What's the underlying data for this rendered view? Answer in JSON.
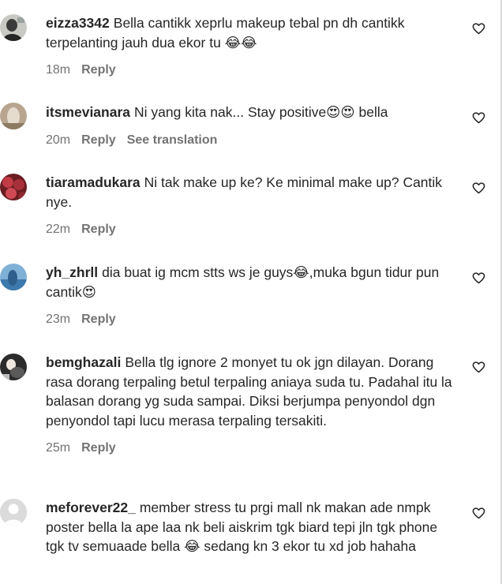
{
  "comments": [
    {
      "username": "eizza3342",
      "text": "Bella cantikk xeprlu makeup tebal pn dh cantikk terpelanting jauh dua ekor tu 😂😂",
      "time": "18m",
      "reply_label": "Reply"
    },
    {
      "username": "itsmevianara",
      "text": "Ni yang kita nak... Stay positive😍😍 bella",
      "time": "20m",
      "reply_label": "Reply",
      "translate_label": "See translation"
    },
    {
      "username": "tiaramadukara",
      "text": "Ni tak make up ke? Ke minimal make up? Cantik nye.",
      "time": "22m",
      "reply_label": "Reply"
    },
    {
      "username": "yh_zhrll",
      "text": "dia buat ig mcm stts ws je guys😂,muka bgun tidur pun cantik😍",
      "time": "23m",
      "reply_label": "Reply"
    },
    {
      "username": "bemghazali",
      "text": "Bella tlg ignore 2 monyet tu ok jgn dilayan. Dorang rasa dorang terpaling betul terpaling aniaya suda tu. Padahal itu la balasan dorang yg suda sampai. Diksi berjumpa penyondol dgn penyondol tapi lucu merasa terpaling tersakiti.",
      "time": "25m",
      "reply_label": "Reply"
    },
    {
      "username": "meforever22_",
      "text": "member stress tu prgi mall nk makan ade nmpk poster bella la ape laa nk beli aiskrim tgk biard tepi jln tgk phone tgk tv semuaade bella 😂 sedang kn 3 ekor tu xd job hahaha"
    }
  ]
}
